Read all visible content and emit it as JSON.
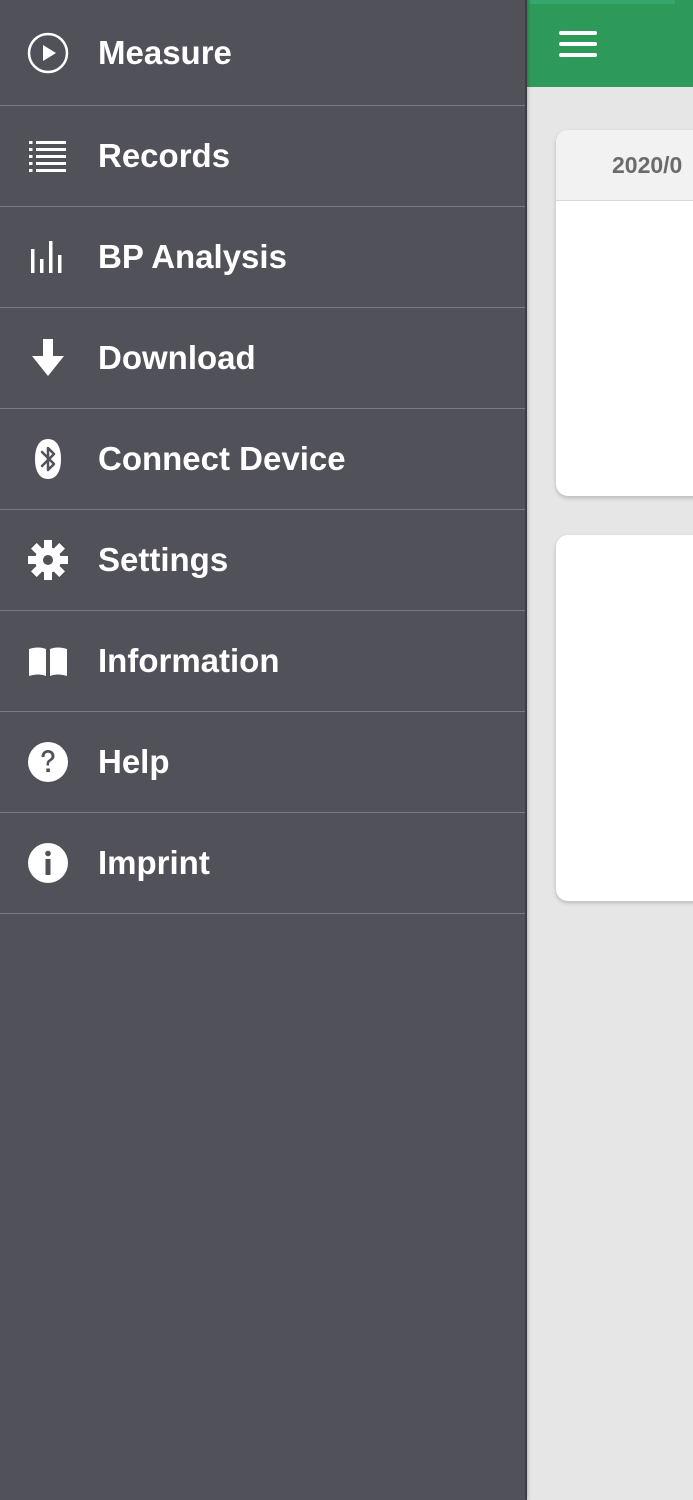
{
  "main": {
    "card1": {
      "date_text": "2020/0"
    }
  },
  "menu": {
    "items": [
      {
        "label": "Measure",
        "icon": "play-circle-icon"
      },
      {
        "label": "Records",
        "icon": "list-icon"
      },
      {
        "label": "BP Analysis",
        "icon": "bar-chart-icon"
      },
      {
        "label": "Download",
        "icon": "download-arrow-icon"
      },
      {
        "label": "Connect Device",
        "icon": "bluetooth-icon"
      },
      {
        "label": "Settings",
        "icon": "gear-icon"
      },
      {
        "label": "Information",
        "icon": "book-icon"
      },
      {
        "label": "Help",
        "icon": "question-circle-icon"
      },
      {
        "label": "Imprint",
        "icon": "info-circle-icon"
      }
    ]
  },
  "colors": {
    "drawer_bg": "#51515a",
    "appbar": "#2e9a5a",
    "content_bg": "#e6e6e6",
    "text": "#ffffff"
  }
}
